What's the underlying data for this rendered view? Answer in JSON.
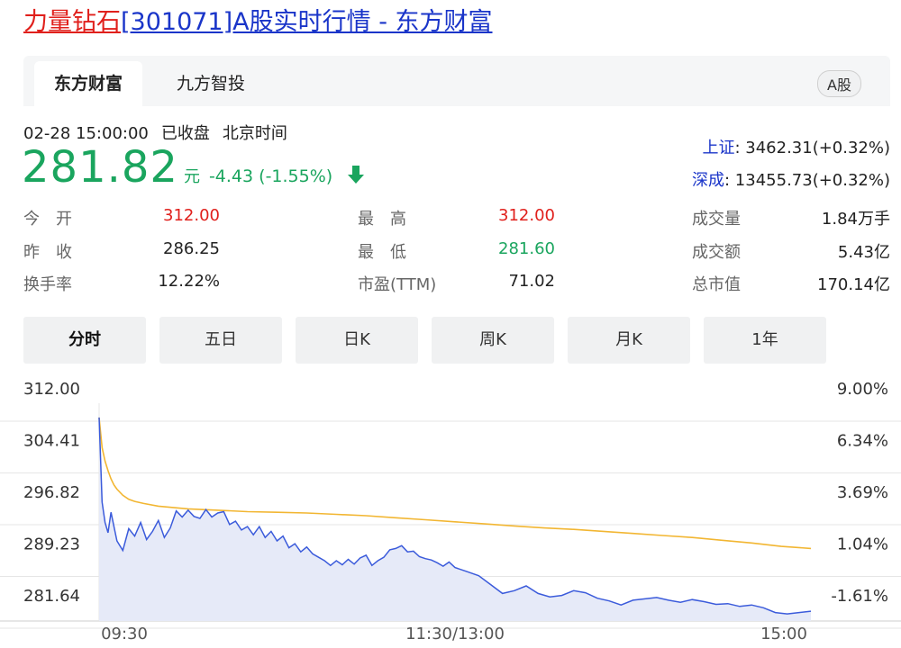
{
  "page": {
    "title_stock": "力量钻石",
    "title_rest": "[301071]A股实时行情 - 东方财富"
  },
  "tabs": [
    {
      "label": "东方财富",
      "active": true
    },
    {
      "label": "九方智投",
      "active": false
    }
  ],
  "market_badge": "A股",
  "quote": {
    "datetime": "02-28 15:00:00",
    "status": "已收盘",
    "timezone": "北京时间",
    "price": "281.82",
    "unit": "元",
    "change": "-4.43 (-1.55%)",
    "trend": "down",
    "color": "#1aa55e"
  },
  "indices": [
    {
      "name": "上证",
      "value": ": 3462.31(+0.32%)"
    },
    {
      "name": "深成",
      "value": ": 13455.73(+0.32%)"
    }
  ],
  "stats": {
    "col1": [
      {
        "label": "今　开",
        "value": "312.00",
        "color": "#e0201c"
      },
      {
        "label": "昨　收",
        "value": "286.25",
        "color": "#222222"
      },
      {
        "label": "换手率",
        "value": "12.22%",
        "color": "#222222"
      }
    ],
    "col2": [
      {
        "label": "最　高",
        "value": "312.00",
        "color": "#e0201c"
      },
      {
        "label": "最　低",
        "value": "281.60",
        "color": "#1aa55e"
      },
      {
        "label": "市盈(TTM)",
        "value": "71.02",
        "color": "#222222"
      }
    ],
    "col3": [
      {
        "label": "成交量",
        "value": "1.84万手",
        "color": "#222222"
      },
      {
        "label": "成交额",
        "value": "5.43亿",
        "color": "#222222"
      },
      {
        "label": "总市值",
        "value": "170.14亿",
        "color": "#222222"
      }
    ]
  },
  "periods": [
    {
      "label": "分时",
      "active": true
    },
    {
      "label": "五日",
      "active": false
    },
    {
      "label": "日K",
      "active": false
    },
    {
      "label": "周K",
      "active": false
    },
    {
      "label": "月K",
      "active": false
    },
    {
      "label": "1年",
      "active": false
    }
  ],
  "chart_data": {
    "type": "line",
    "y_ticks": [
      "312.00",
      "304.41",
      "296.82",
      "289.23",
      "281.64"
    ],
    "y2_ticks": [
      "9.00%",
      "6.34%",
      "3.69%",
      "1.04%",
      "-1.61%"
    ],
    "x_ticks": [
      "09:30",
      "11:30/13:00",
      "15:00"
    ],
    "ylim": [
      281.64,
      312.0
    ],
    "x_range": [
      0,
      240
    ],
    "series": [
      {
        "color": "#3b5bdb",
        "fill": "#e6eaf8",
        "x": [
          0,
          1,
          2,
          3,
          4,
          6,
          8,
          10,
          12,
          14,
          16,
          18,
          20,
          22,
          24,
          26,
          28,
          30,
          32,
          34,
          36,
          38,
          40,
          42,
          44,
          46,
          48,
          50,
          52,
          54,
          56,
          58,
          60,
          62,
          64,
          66,
          68,
          70,
          72,
          74,
          76,
          78,
          80,
          82,
          84,
          86,
          88,
          90,
          92,
          94,
          96,
          98,
          100,
          102,
          104,
          106,
          108,
          110,
          112,
          114,
          116,
          118,
          120,
          124,
          128,
          132,
          136,
          140,
          144,
          148,
          152,
          156,
          160,
          164,
          168,
          172,
          176,
          180,
          184,
          188,
          192,
          196,
          200,
          204,
          208,
          212,
          216,
          220,
          224,
          228,
          232,
          236,
          240
        ],
        "values": [
          309.9,
          297.5,
          294.5,
          293.0,
          296.0,
          291.8,
          290.4,
          293.6,
          292.5,
          294.5,
          292.0,
          293.2,
          294.8,
          292.3,
          293.7,
          296.2,
          295.3,
          296.3,
          295.4,
          295.1,
          296.4,
          295.3,
          295.9,
          296.1,
          294.2,
          294.7,
          293.4,
          293.9,
          292.7,
          293.9,
          292.3,
          293.2,
          291.8,
          292.5,
          290.8,
          291.4,
          290.2,
          290.9,
          289.9,
          289.4,
          288.9,
          288.2,
          288.9,
          288.3,
          289.1,
          288.4,
          289.3,
          289.7,
          288.2,
          288.9,
          289.4,
          290.5,
          290.7,
          291.1,
          290.2,
          290.3,
          289.5,
          289.2,
          289.0,
          288.6,
          288.1,
          288.7,
          287.9,
          287.3,
          286.7,
          285.4,
          284.1,
          284.5,
          285.2,
          284.1,
          283.6,
          283.8,
          284.5,
          284.2,
          283.4,
          283.0,
          282.4,
          283.1,
          283.3,
          283.5,
          283.1,
          282.8,
          283.2,
          282.9,
          282.5,
          282.6,
          282.2,
          282.4,
          282.0,
          281.3,
          281.1,
          281.3,
          281.5
        ]
      },
      {
        "color": "#f2b632",
        "x": [
          0,
          1,
          2,
          3,
          4,
          5,
          6,
          8,
          10,
          12,
          15,
          20,
          25,
          30,
          40,
          50,
          60,
          70,
          80,
          90,
          100,
          110,
          120,
          130,
          140,
          150,
          160,
          170,
          180,
          190,
          200,
          210,
          220,
          230,
          240
        ],
        "values": [
          309.9,
          305.5,
          303.5,
          302.1,
          300.9,
          300.0,
          299.4,
          298.5,
          297.9,
          297.6,
          297.3,
          296.9,
          296.7,
          296.5,
          296.3,
          296.1,
          296.0,
          295.9,
          295.7,
          295.5,
          295.2,
          294.9,
          294.6,
          294.3,
          294.0,
          293.7,
          293.5,
          293.2,
          292.9,
          292.6,
          292.3,
          291.9,
          291.5,
          291.0,
          290.7
        ]
      }
    ]
  }
}
